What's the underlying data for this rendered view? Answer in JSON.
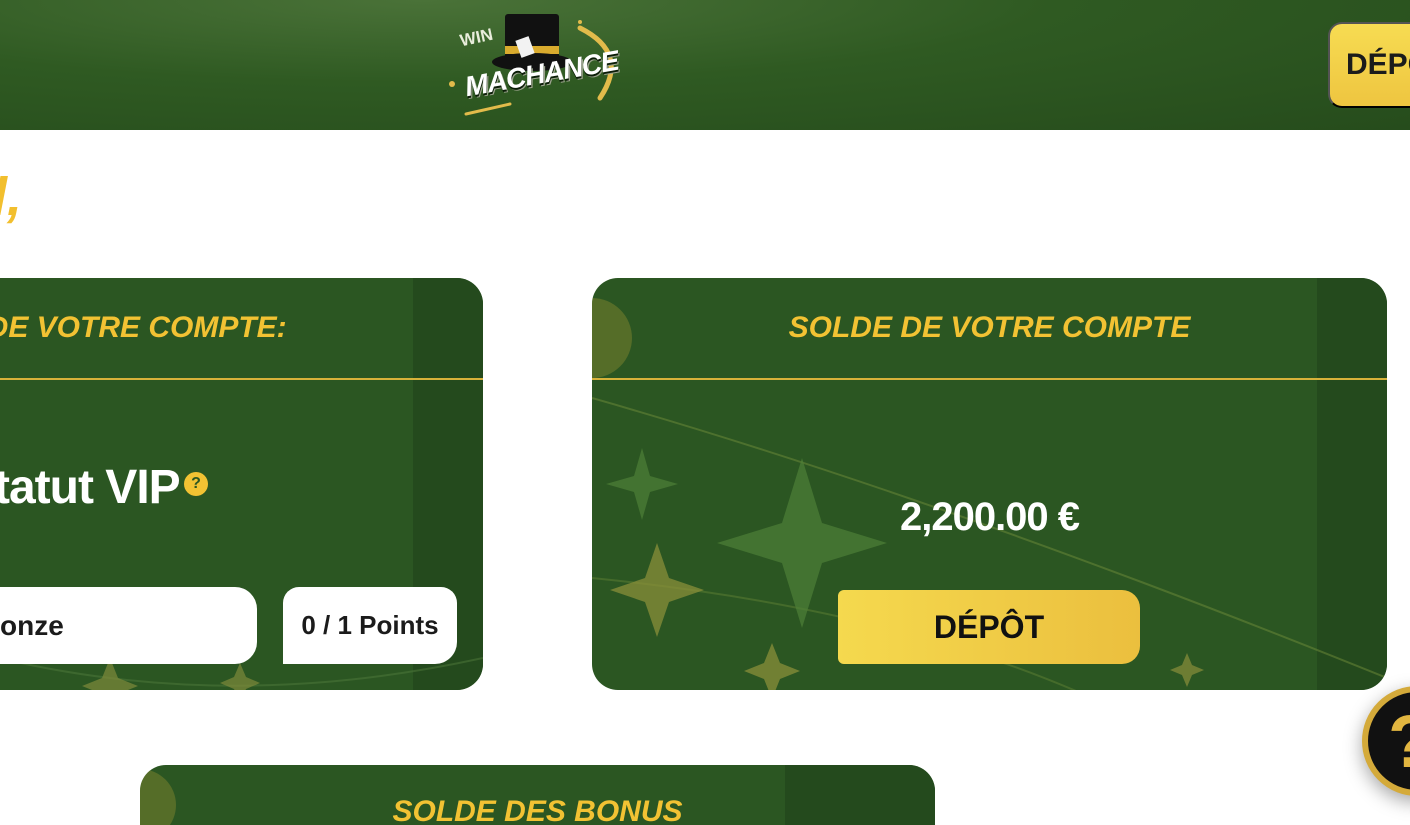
{
  "header": {
    "logo_top": "WIN",
    "logo_main": "MACHANCE",
    "deposit_label": "DÉPÔT"
  },
  "greeting": {
    "text": "l,"
  },
  "vip_card": {
    "title": "T DE VOTRE COMPTE:",
    "vip_label": "tatut VIP",
    "help_glyph": "?",
    "tier": "onze",
    "points": "0 / 1 Points"
  },
  "balance_card": {
    "title": "SOLDE DE VOTRE COMPTE",
    "amount": "2,200.00 €",
    "deposit_label": "DÉPÔT"
  },
  "bonus_card": {
    "title": "SOLDE DES BONUS"
  },
  "help_button": {
    "glyph": "?"
  },
  "colors": {
    "brand_green": "#2b5622",
    "gold": "#f2c233",
    "button_gold": "#f5d94e"
  },
  "icons": [
    "top-hat-logo-icon",
    "help-circle-icon",
    "question-mark-icon"
  ]
}
